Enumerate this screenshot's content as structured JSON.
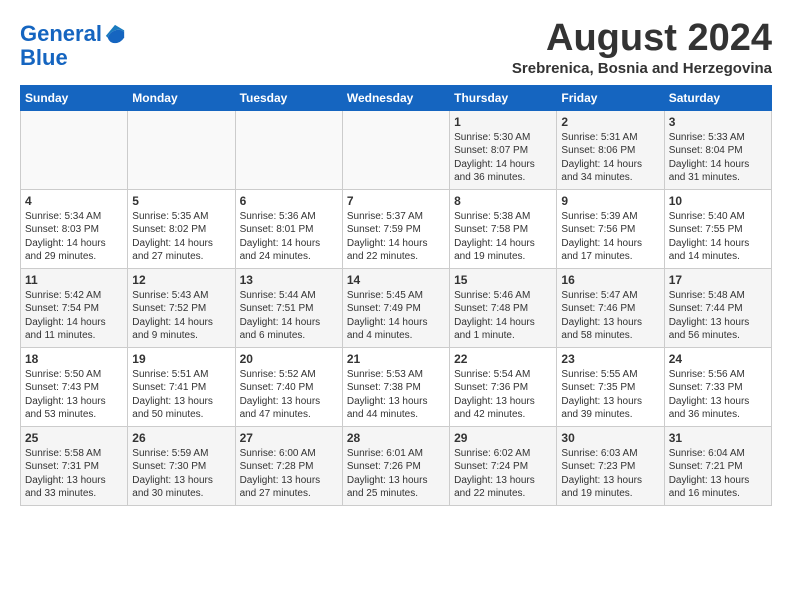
{
  "header": {
    "logo_line1": "General",
    "logo_line2": "Blue",
    "month": "August 2024",
    "location": "Srebrenica, Bosnia and Herzegovina"
  },
  "days_of_week": [
    "Sunday",
    "Monday",
    "Tuesday",
    "Wednesday",
    "Thursday",
    "Friday",
    "Saturday"
  ],
  "weeks": [
    [
      {
        "day": "",
        "info": ""
      },
      {
        "day": "",
        "info": ""
      },
      {
        "day": "",
        "info": ""
      },
      {
        "day": "",
        "info": ""
      },
      {
        "day": "1",
        "info": "Sunrise: 5:30 AM\nSunset: 8:07 PM\nDaylight: 14 hours\nand 36 minutes."
      },
      {
        "day": "2",
        "info": "Sunrise: 5:31 AM\nSunset: 8:06 PM\nDaylight: 14 hours\nand 34 minutes."
      },
      {
        "day": "3",
        "info": "Sunrise: 5:33 AM\nSunset: 8:04 PM\nDaylight: 14 hours\nand 31 minutes."
      }
    ],
    [
      {
        "day": "4",
        "info": "Sunrise: 5:34 AM\nSunset: 8:03 PM\nDaylight: 14 hours\nand 29 minutes."
      },
      {
        "day": "5",
        "info": "Sunrise: 5:35 AM\nSunset: 8:02 PM\nDaylight: 14 hours\nand 27 minutes."
      },
      {
        "day": "6",
        "info": "Sunrise: 5:36 AM\nSunset: 8:01 PM\nDaylight: 14 hours\nand 24 minutes."
      },
      {
        "day": "7",
        "info": "Sunrise: 5:37 AM\nSunset: 7:59 PM\nDaylight: 14 hours\nand 22 minutes."
      },
      {
        "day": "8",
        "info": "Sunrise: 5:38 AM\nSunset: 7:58 PM\nDaylight: 14 hours\nand 19 minutes."
      },
      {
        "day": "9",
        "info": "Sunrise: 5:39 AM\nSunset: 7:56 PM\nDaylight: 14 hours\nand 17 minutes."
      },
      {
        "day": "10",
        "info": "Sunrise: 5:40 AM\nSunset: 7:55 PM\nDaylight: 14 hours\nand 14 minutes."
      }
    ],
    [
      {
        "day": "11",
        "info": "Sunrise: 5:42 AM\nSunset: 7:54 PM\nDaylight: 14 hours\nand 11 minutes."
      },
      {
        "day": "12",
        "info": "Sunrise: 5:43 AM\nSunset: 7:52 PM\nDaylight: 14 hours\nand 9 minutes."
      },
      {
        "day": "13",
        "info": "Sunrise: 5:44 AM\nSunset: 7:51 PM\nDaylight: 14 hours\nand 6 minutes."
      },
      {
        "day": "14",
        "info": "Sunrise: 5:45 AM\nSunset: 7:49 PM\nDaylight: 14 hours\nand 4 minutes."
      },
      {
        "day": "15",
        "info": "Sunrise: 5:46 AM\nSunset: 7:48 PM\nDaylight: 14 hours\nand 1 minute."
      },
      {
        "day": "16",
        "info": "Sunrise: 5:47 AM\nSunset: 7:46 PM\nDaylight: 13 hours\nand 58 minutes."
      },
      {
        "day": "17",
        "info": "Sunrise: 5:48 AM\nSunset: 7:44 PM\nDaylight: 13 hours\nand 56 minutes."
      }
    ],
    [
      {
        "day": "18",
        "info": "Sunrise: 5:50 AM\nSunset: 7:43 PM\nDaylight: 13 hours\nand 53 minutes."
      },
      {
        "day": "19",
        "info": "Sunrise: 5:51 AM\nSunset: 7:41 PM\nDaylight: 13 hours\nand 50 minutes."
      },
      {
        "day": "20",
        "info": "Sunrise: 5:52 AM\nSunset: 7:40 PM\nDaylight: 13 hours\nand 47 minutes."
      },
      {
        "day": "21",
        "info": "Sunrise: 5:53 AM\nSunset: 7:38 PM\nDaylight: 13 hours\nand 44 minutes."
      },
      {
        "day": "22",
        "info": "Sunrise: 5:54 AM\nSunset: 7:36 PM\nDaylight: 13 hours\nand 42 minutes."
      },
      {
        "day": "23",
        "info": "Sunrise: 5:55 AM\nSunset: 7:35 PM\nDaylight: 13 hours\nand 39 minutes."
      },
      {
        "day": "24",
        "info": "Sunrise: 5:56 AM\nSunset: 7:33 PM\nDaylight: 13 hours\nand 36 minutes."
      }
    ],
    [
      {
        "day": "25",
        "info": "Sunrise: 5:58 AM\nSunset: 7:31 PM\nDaylight: 13 hours\nand 33 minutes."
      },
      {
        "day": "26",
        "info": "Sunrise: 5:59 AM\nSunset: 7:30 PM\nDaylight: 13 hours\nand 30 minutes."
      },
      {
        "day": "27",
        "info": "Sunrise: 6:00 AM\nSunset: 7:28 PM\nDaylight: 13 hours\nand 27 minutes."
      },
      {
        "day": "28",
        "info": "Sunrise: 6:01 AM\nSunset: 7:26 PM\nDaylight: 13 hours\nand 25 minutes."
      },
      {
        "day": "29",
        "info": "Sunrise: 6:02 AM\nSunset: 7:24 PM\nDaylight: 13 hours\nand 22 minutes."
      },
      {
        "day": "30",
        "info": "Sunrise: 6:03 AM\nSunset: 7:23 PM\nDaylight: 13 hours\nand 19 minutes."
      },
      {
        "day": "31",
        "info": "Sunrise: 6:04 AM\nSunset: 7:21 PM\nDaylight: 13 hours\nand 16 minutes."
      }
    ]
  ]
}
